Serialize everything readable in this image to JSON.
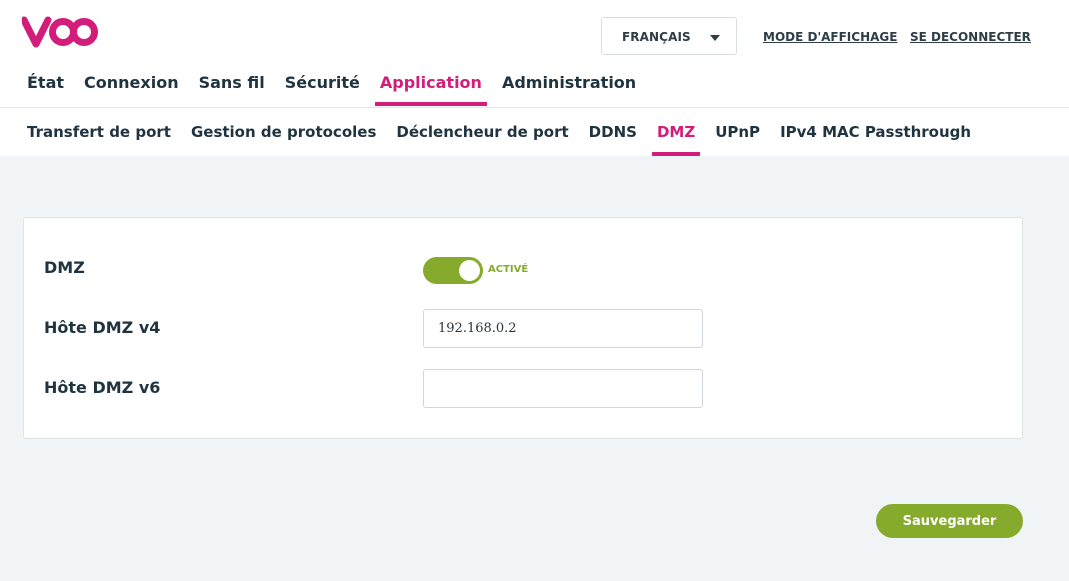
{
  "brand": {
    "logo_text": "voo",
    "accent": "#d21e7a",
    "green": "#86ab2c"
  },
  "header": {
    "language": {
      "selected": "FRANÇAIS",
      "icon": "chevron-down-icon"
    },
    "display_mode_label": "MODE D'AFFICHAGE",
    "logout_label": "SE DECONNECTER"
  },
  "main_nav": {
    "items": [
      {
        "label": "État"
      },
      {
        "label": "Connexion"
      },
      {
        "label": "Sans fil"
      },
      {
        "label": "Sécurité"
      },
      {
        "label": "Application"
      },
      {
        "label": "Administration"
      }
    ],
    "active": "Application"
  },
  "sub_nav": {
    "items": [
      {
        "label": "Transfert de port"
      },
      {
        "label": "Gestion de protocoles"
      },
      {
        "label": "Déclencheur de port"
      },
      {
        "label": "DDNS"
      },
      {
        "label": "DMZ"
      },
      {
        "label": "UPnP"
      },
      {
        "label": "IPv4 MAC Passthrough"
      }
    ],
    "active": "DMZ"
  },
  "form": {
    "dmz_label": "DMZ",
    "dmz_toggle_state": "ACTIVÉ",
    "host_v4_label": "Hôte DMZ v4",
    "host_v4_value": "192.168.0.2",
    "host_v6_label": "Hôte DMZ v6",
    "host_v6_value": ""
  },
  "save_label": "Sauvegarder"
}
